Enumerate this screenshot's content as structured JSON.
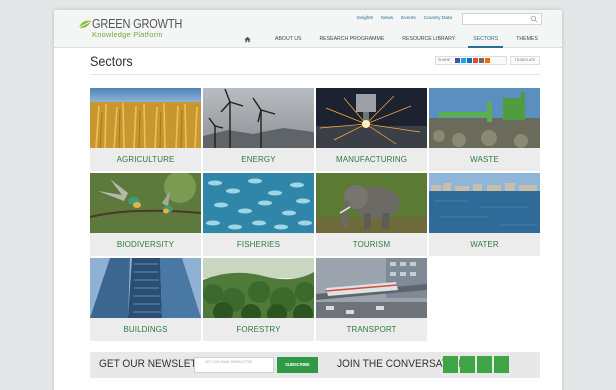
{
  "header": {
    "logo_title": "GREEN GROWTH",
    "logo_subtitle": "Knowledge Platform",
    "top_links": [
      "Insights",
      "News",
      "Events",
      "Country Data"
    ],
    "search_placeholder": "",
    "nav": [
      "ABOUT US",
      "RESEARCH PROGRAMME",
      "RESOURCE LIBRARY",
      "SECTORS",
      "THEMES"
    ],
    "active_nav": "SECTORS"
  },
  "page": {
    "title": "Sectors",
    "share_label": "SHARE",
    "translate_label": "TRANSLATE"
  },
  "sectors": [
    {
      "label": "AGRICULTURE",
      "image": "wheat-field"
    },
    {
      "label": "ENERGY",
      "image": "wind-turbines"
    },
    {
      "label": "MANUFACTURING",
      "image": "welding-sparks"
    },
    {
      "label": "WASTE",
      "image": "landfill-pipes"
    },
    {
      "label": "BIODIVERSITY",
      "image": "birds"
    },
    {
      "label": "FISHERIES",
      "image": "fish-school"
    },
    {
      "label": "TOURISM",
      "image": "elephant"
    },
    {
      "label": "WATER",
      "image": "waterfront"
    },
    {
      "label": "BUILDINGS",
      "image": "skyscrapers"
    },
    {
      "label": "FORESTRY",
      "image": "forest"
    },
    {
      "label": "TRANSPORT",
      "image": "train"
    }
  ],
  "footer": {
    "newsletter_title": "GET OUR NEWSLETTER",
    "newsletter_placeholder": "GET OUR EMAIL NEWSLETTER",
    "subscribe_label": "SUBSCRIBE",
    "conversation_title": "JOIN THE CONVERSATION",
    "social_count": 4
  },
  "colors": {
    "accent_blue": "#2a6f96",
    "sector_green": "#2f7a43",
    "subscribe_green": "#2f9a45",
    "social_green": "#3fa648"
  }
}
